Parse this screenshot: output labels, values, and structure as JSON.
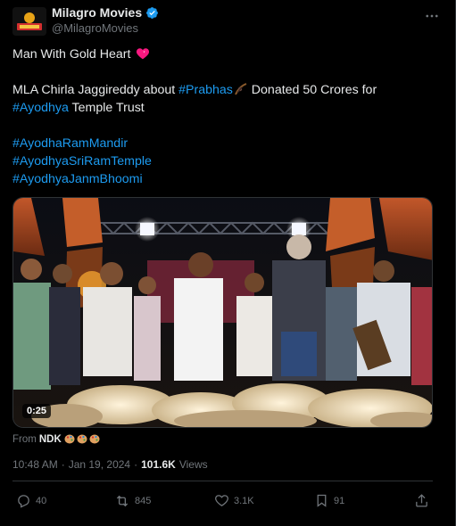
{
  "account": {
    "display_name": "Milagro Movies",
    "handle": "@MilagroMovies",
    "avatar_text": "MILAGRO"
  },
  "tweet": {
    "line1": "Man With Gold Heart",
    "line2_prefix": "MLA Chirla Jaggireddy about ",
    "line2_hashtag": "#Prabhas",
    "line2_suffix": " Donated 50 Crores for",
    "line3_hashtag": "#Ayodhya",
    "line3_suffix": " Temple Trust",
    "hashtags": [
      "#AyodhaRamMandir",
      "#AyodhyaSriRamTemple",
      "#AyodhyaJanmBhoomi"
    ]
  },
  "media": {
    "duration": "0:25"
  },
  "from": {
    "label": "From",
    "name": "NDK"
  },
  "meta": {
    "time": "10:48 AM",
    "separator": "·",
    "date": "Jan 19, 2024",
    "views_count": "101.6K",
    "views_label": "Views"
  },
  "actions": {
    "replies": "40",
    "reposts": "845",
    "likes": "3.1K",
    "bookmarks": "91"
  },
  "colors": {
    "background": "#000000",
    "text": "#e7e9ea",
    "muted": "#71767b",
    "link": "#1d9bf0",
    "verified": "#1d9bf0",
    "border": "#2f3336"
  }
}
